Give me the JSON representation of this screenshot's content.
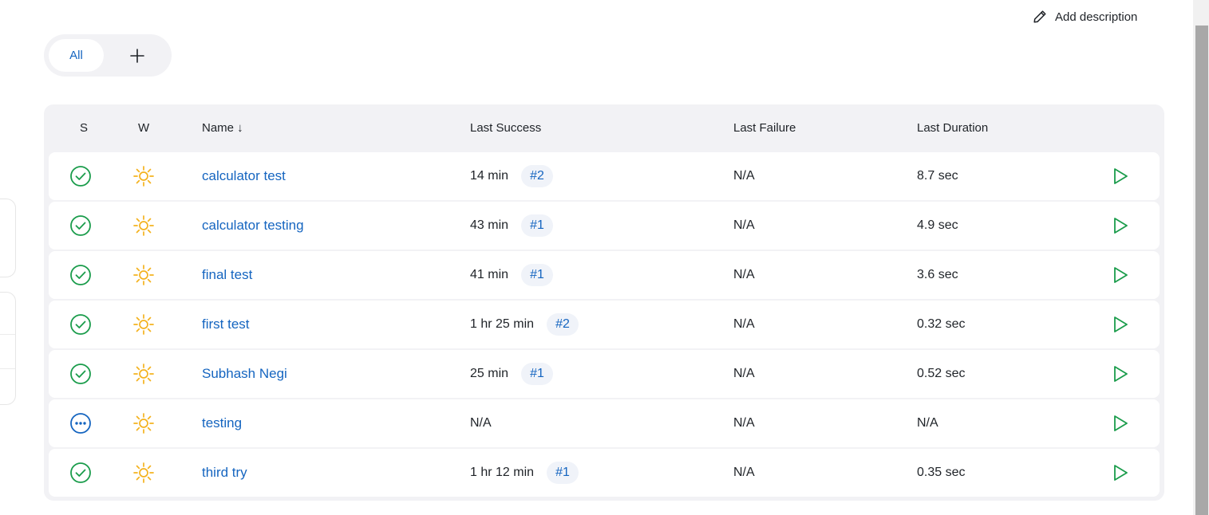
{
  "header": {
    "add_description_label": "Add description"
  },
  "view_tabs": {
    "all_label": "All",
    "add_icon": "plus-icon"
  },
  "table": {
    "columns": {
      "status": "S",
      "weather": "W",
      "name": "Name ↓",
      "last_success": "Last Success",
      "last_failure": "Last Failure",
      "last_duration": "Last Duration"
    },
    "rows": [
      {
        "status": "success",
        "weather": "sunny",
        "name": "calculator test",
        "last_success": "14 min",
        "build": "#2",
        "last_failure": "N/A",
        "last_duration": "8.7 sec"
      },
      {
        "status": "success",
        "weather": "sunny",
        "name": "calculator testing",
        "last_success": "43 min",
        "build": "#1",
        "last_failure": "N/A",
        "last_duration": "4.9 sec"
      },
      {
        "status": "success",
        "weather": "sunny",
        "name": "final test",
        "last_success": "41 min",
        "build": "#1",
        "last_failure": "N/A",
        "last_duration": "3.6 sec"
      },
      {
        "status": "success",
        "weather": "sunny",
        "name": "first test",
        "last_success": "1 hr 25 min",
        "build": "#2",
        "last_failure": "N/A",
        "last_duration": "0.32 sec"
      },
      {
        "status": "success",
        "weather": "sunny",
        "name": "Subhash Negi",
        "last_success": "25 min",
        "build": "#1",
        "last_failure": "N/A",
        "last_duration": "0.52 sec"
      },
      {
        "status": "not_built",
        "weather": "sunny",
        "name": "testing",
        "last_success": "N/A",
        "build": "",
        "last_failure": "N/A",
        "last_duration": "N/A"
      },
      {
        "status": "success",
        "weather": "sunny",
        "name": "third try",
        "last_success": "1 hr 12 min",
        "build": "#1",
        "last_failure": "N/A",
        "last_duration": "0.35 sec"
      }
    ]
  },
  "colors": {
    "link": "#1565c0",
    "success": "#1a9c4b",
    "not_built": "#1565c0",
    "sunny": "#f4b21e",
    "run": "#1a9c4b",
    "table_bg": "#f2f2f5"
  }
}
